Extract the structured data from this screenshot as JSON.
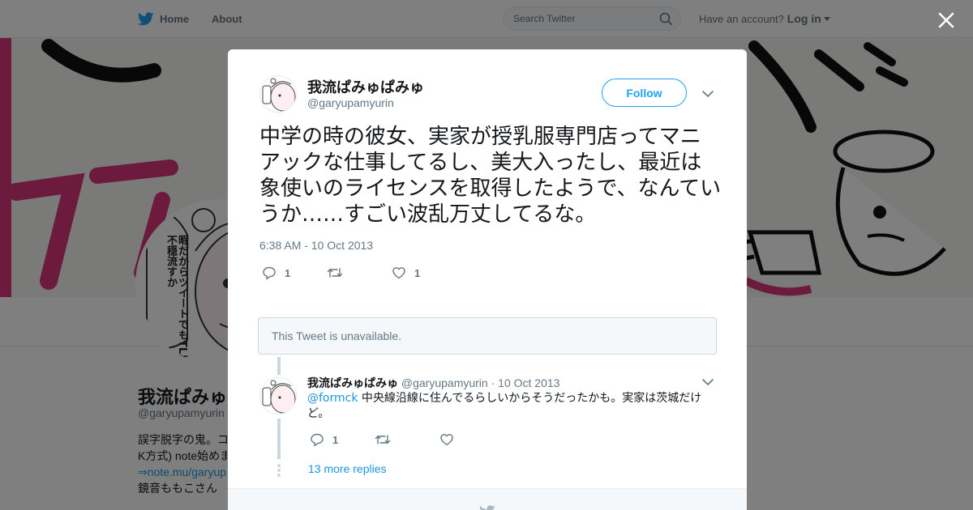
{
  "nav": {
    "home_label": "Home",
    "about_label": "About",
    "search_placeholder": "Search Twitter",
    "have_account": "Have an account?",
    "login_label": "Log in"
  },
  "profile": {
    "name": "我流ぱみゅぱみゅ",
    "handle": "@garyupamyurin",
    "bio_lines": [
      "誤字脱字の鬼。コ",
      "K方式) note始めま",
      "⇒note.mu/garyup",
      "鏡音ももこさん"
    ],
    "avatar_text": "暇だからツイートでもTLに不穏流すか"
  },
  "tweet": {
    "name": "我流ぱみゅぱみゅ",
    "handle": "@garyupamyurin",
    "follow_label": "Follow",
    "text": "中学の時の彼女、実家が授乳服専門店ってマニアックな仕事してるし、美大入ったし、最近は象使いのライセンスを取得したようで、なんていうか……すごい波乱万丈してるな。",
    "timestamp": "6:38 AM - 10 Oct 2013",
    "reply_count": "1",
    "like_count": "1"
  },
  "unavailable_text": "This Tweet is unavailable.",
  "reply": {
    "name": "我流ぱみゅぱみゅ",
    "handle": "@garyupamyurin",
    "separator": "·",
    "date": "10 Oct 2013",
    "mention": "@formck",
    "text": "中央線沿線に住んでるらしいからそうだったかも。実家は茨城だけど。",
    "reply_count": "1"
  },
  "more_replies": "13 more replies",
  "colors": {
    "brand_blue": "#1da1f2",
    "link_blue": "#1b95e0",
    "banner_pink": "#d8357a"
  },
  "icons": [
    "twitter-bird-icon",
    "search-icon",
    "close-icon",
    "chevron-down-icon",
    "reply-icon",
    "retweet-icon",
    "heart-icon"
  ]
}
